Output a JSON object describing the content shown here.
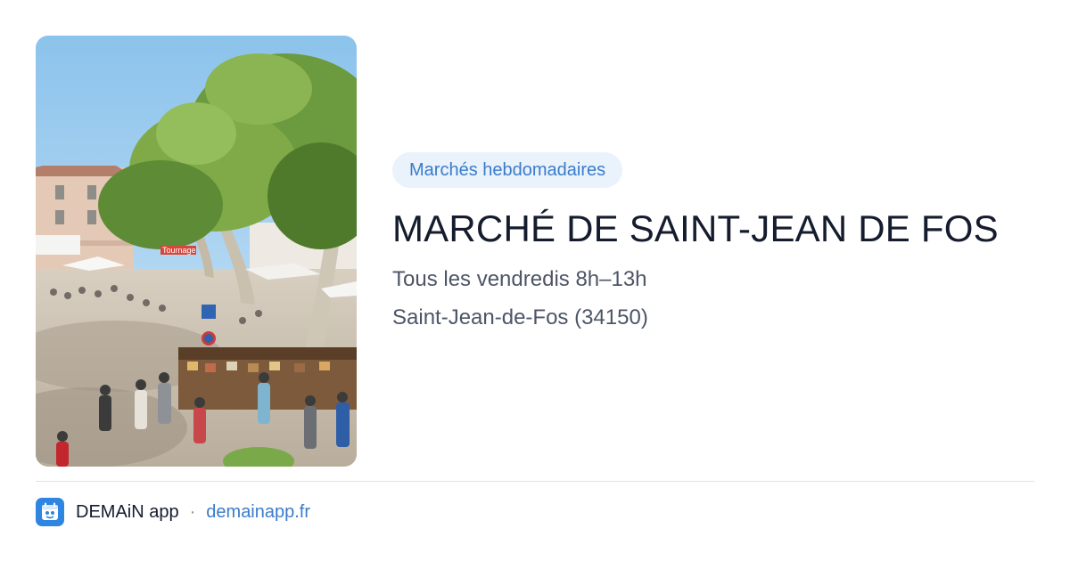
{
  "card": {
    "category": "Marchés hebdomadaires",
    "title": "MARCHÉ DE SAINT-JEAN DE FOS",
    "schedule": "Tous les vendredis 8h–13h",
    "location": "Saint-Jean-de-Fos (34150)"
  },
  "photo": {
    "subject": "market-square-photo",
    "sign_text": "Tournage"
  },
  "footer": {
    "app_name": "DEMAiN app",
    "separator": "·",
    "domain": "demainapp.fr",
    "icon": "app-logo-icon"
  },
  "colors": {
    "accent": "#3a7ccc",
    "chip_background": "#eaf2fb",
    "title": "#141c2e",
    "body_text": "#4d5566",
    "app_icon": "#2f86e0"
  }
}
